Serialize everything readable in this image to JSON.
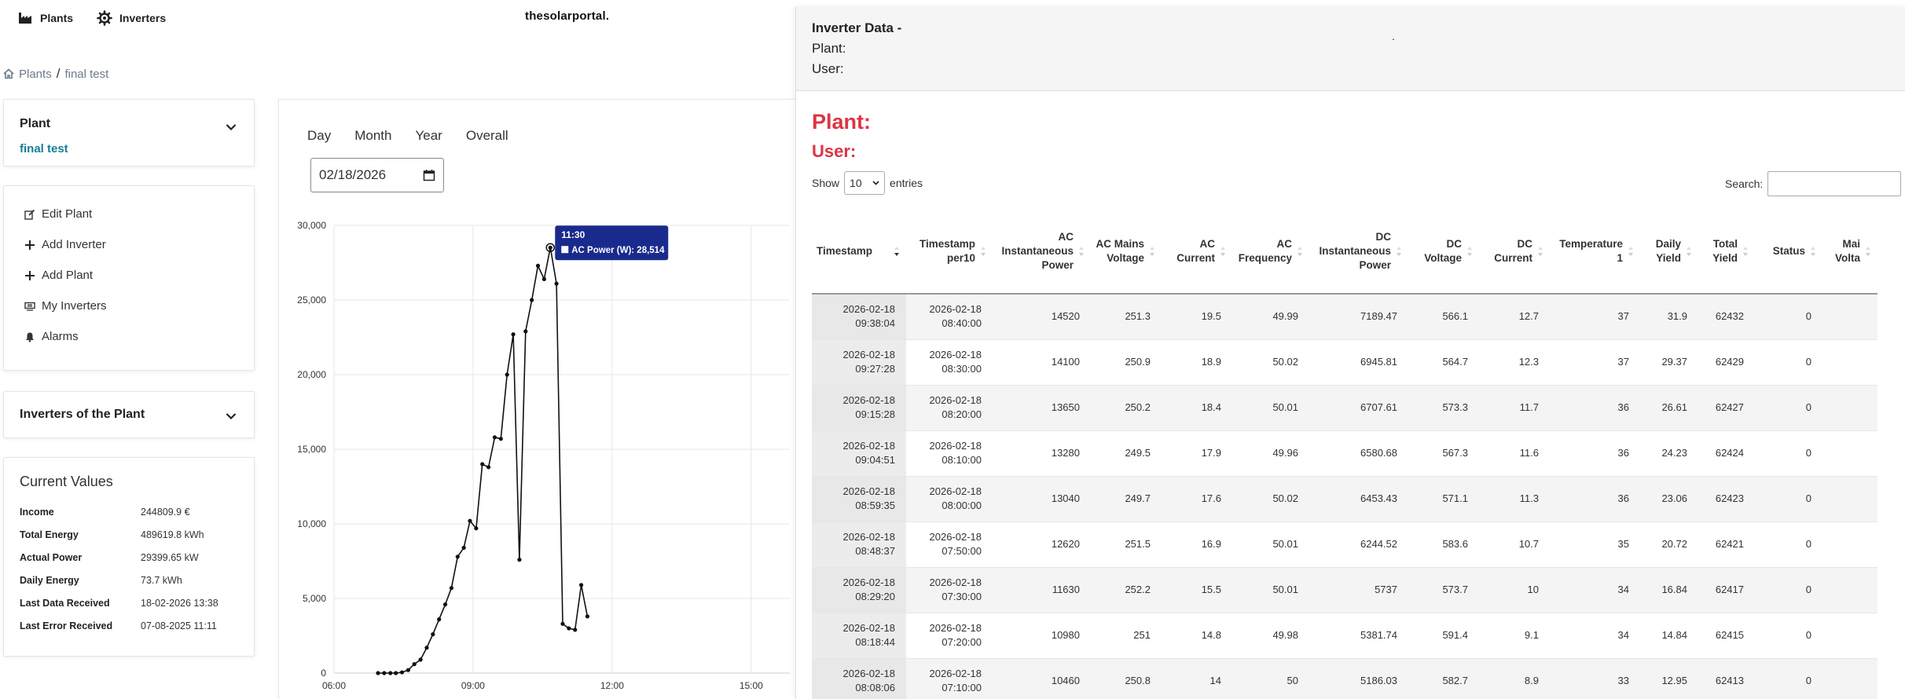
{
  "nav": {
    "plants_label": "Plants",
    "inverters_label": "Inverters",
    "brand": "thesolarportal."
  },
  "breadcrumb": {
    "home_label": "Plants",
    "separator": "/",
    "current": "final test"
  },
  "plant_card": {
    "title": "Plant",
    "name": "final test"
  },
  "actions": [
    {
      "label": "Edit Plant",
      "icon": "edit-icon"
    },
    {
      "label": "Add Inverter",
      "icon": "plus-icon"
    },
    {
      "label": "Add Plant",
      "icon": "plus-icon"
    },
    {
      "label": "My Inverters",
      "icon": "inverter-icon"
    },
    {
      "label": "Alarms",
      "icon": "bell-icon"
    }
  ],
  "inverters_card": {
    "title": "Inverters of the Plant"
  },
  "current_values": {
    "title": "Current Values",
    "items": [
      {
        "label": "Income",
        "value": "244809.9 €"
      },
      {
        "label": "Total Energy",
        "value": "489619.8 kWh"
      },
      {
        "label": "Actual Power",
        "value": "29399.65 kW"
      },
      {
        "label": "Daily Energy",
        "value": "73.7 kWh"
      },
      {
        "label": "Last Data Received",
        "value": "18-02-2026 13:38"
      },
      {
        "label": "Last Error Received",
        "value": "07-08-2025 11:11"
      }
    ]
  },
  "chart_tabs": [
    "Day",
    "Month",
    "Year",
    "Overall"
  ],
  "date_value": "02/18/2026",
  "chart_data": {
    "type": "line",
    "series": [
      {
        "name": "AC Power (W)",
        "points": [
          [
            "06:57",
            0
          ],
          [
            "07:05",
            0
          ],
          [
            "07:13",
            0
          ],
          [
            "07:20",
            0
          ],
          [
            "07:28",
            50
          ],
          [
            "07:36",
            200
          ],
          [
            "07:44",
            600
          ],
          [
            "07:52",
            900
          ],
          [
            "08:00",
            1700
          ],
          [
            "08:08",
            2600
          ],
          [
            "08:16",
            3600
          ],
          [
            "08:24",
            4600
          ],
          [
            "08:32",
            5700
          ],
          [
            "08:40",
            7800
          ],
          [
            "08:48",
            8400
          ],
          [
            "08:56",
            10200
          ],
          [
            "09:04",
            9700
          ],
          [
            "09:12",
            14000
          ],
          [
            "09:20",
            13800
          ],
          [
            "09:28",
            15800
          ],
          [
            "09:36",
            15700
          ],
          [
            "09:44",
            20000
          ],
          [
            "09:52",
            22700
          ],
          [
            "10:00",
            7600
          ],
          [
            "10:08",
            22900
          ],
          [
            "10:16",
            25000
          ],
          [
            "10:24",
            27300
          ],
          [
            "10:32",
            26400
          ],
          [
            "10:40",
            28514
          ],
          [
            "10:48",
            26100
          ],
          [
            "10:56",
            3300
          ],
          [
            "11:04",
            3000
          ],
          [
            "11:12",
            2900
          ],
          [
            "11:20",
            5900
          ],
          [
            "11:28",
            3800
          ]
        ]
      }
    ],
    "tooltip": {
      "time": "11:30",
      "label": "AC Power (W): 28,514"
    },
    "x_ticks": [
      "06:00",
      "09:00",
      "12:00",
      "15:00"
    ],
    "y_ticks": [
      "0",
      "5,000",
      "10,000",
      "15,000",
      "20,000",
      "25,000",
      "30,000"
    ],
    "ylim": [
      0,
      30000
    ],
    "grid": true
  },
  "right_panel": {
    "title": "Inverter Data -",
    "plant_label": "Plant:",
    "user_label": "User:",
    "dot": ".",
    "big_plant": "Plant:",
    "big_user": "User:",
    "show_label": "Show",
    "entries_value": "10",
    "entries_label": "entries",
    "search_label": "Search:"
  },
  "table": {
    "headers": [
      "Timestamp",
      "Timestamp per10",
      "AC Instantaneous Power",
      "AC Mains Voltage",
      "AC Current",
      "AC Frequency",
      "DC Instantaneous Power",
      "DC Voltage",
      "DC Current",
      "Temperature 1",
      "Daily Yield",
      "Total Yield",
      "Status",
      "Mai Volta"
    ],
    "rows": [
      [
        "2026-02-18 09:38:04",
        "2026-02-18 08:40:00",
        "14520",
        "251.3",
        "19.5",
        "49.99",
        "7189.47",
        "566.1",
        "12.7",
        "37",
        "31.9",
        "62432",
        "0",
        ""
      ],
      [
        "2026-02-18 09:27:28",
        "2026-02-18 08:30:00",
        "14100",
        "250.9",
        "18.9",
        "50.02",
        "6945.81",
        "564.7",
        "12.3",
        "37",
        "29.37",
        "62429",
        "0",
        ""
      ],
      [
        "2026-02-18 09:15:28",
        "2026-02-18 08:20:00",
        "13650",
        "250.2",
        "18.4",
        "50.01",
        "6707.61",
        "573.3",
        "11.7",
        "36",
        "26.61",
        "62427",
        "0",
        ""
      ],
      [
        "2026-02-18 09:04:51",
        "2026-02-18 08:10:00",
        "13280",
        "249.5",
        "17.9",
        "49.96",
        "6580.68",
        "567.3",
        "11.6",
        "36",
        "24.23",
        "62424",
        "0",
        ""
      ],
      [
        "2026-02-18 08:59:35",
        "2026-02-18 08:00:00",
        "13040",
        "249.7",
        "17.6",
        "50.02",
        "6453.43",
        "571.1",
        "11.3",
        "36",
        "23.06",
        "62423",
        "0",
        ""
      ],
      [
        "2026-02-18 08:48:37",
        "2026-02-18 07:50:00",
        "12620",
        "251.5",
        "16.9",
        "50.01",
        "6244.52",
        "583.6",
        "10.7",
        "35",
        "20.72",
        "62421",
        "0",
        ""
      ],
      [
        "2026-02-18 08:29:20",
        "2026-02-18 07:30:00",
        "11630",
        "252.2",
        "15.5",
        "50.01",
        "5737",
        "573.7",
        "10",
        "34",
        "16.84",
        "62417",
        "0",
        ""
      ],
      [
        "2026-02-18 08:18:44",
        "2026-02-18 07:20:00",
        "10980",
        "251",
        "14.8",
        "49.98",
        "5381.74",
        "591.4",
        "9.1",
        "34",
        "14.84",
        "62415",
        "0",
        ""
      ],
      [
        "2026-02-18 08:08:06",
        "2026-02-18 07:10:00",
        "10460",
        "250.8",
        "14",
        "50",
        "5186.03",
        "582.7",
        "8.9",
        "33",
        "12.95",
        "62413",
        "0",
        ""
      ]
    ]
  }
}
